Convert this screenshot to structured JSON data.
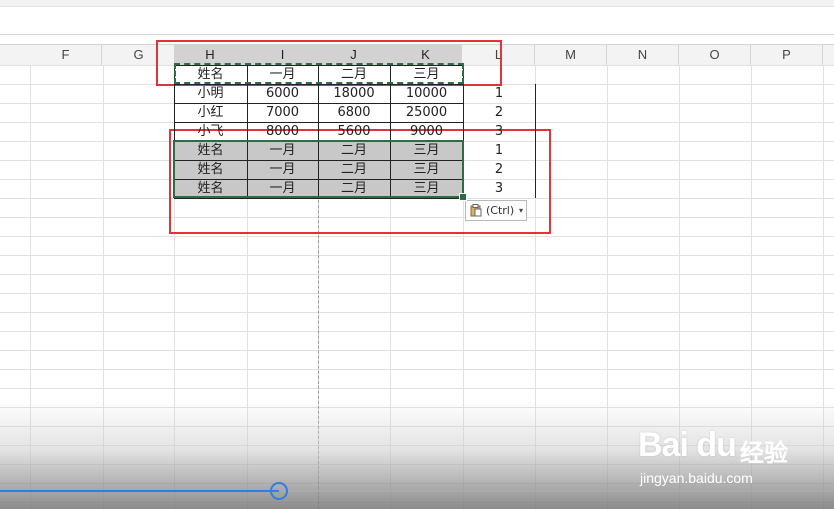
{
  "columns": [
    {
      "id": "F",
      "label": "F",
      "selected": false
    },
    {
      "id": "G",
      "label": "G",
      "selected": false
    },
    {
      "id": "H",
      "label": "H",
      "selected": true
    },
    {
      "id": "I",
      "label": "I",
      "selected": true
    },
    {
      "id": "J",
      "label": "J",
      "selected": true
    },
    {
      "id": "K",
      "label": "K",
      "selected": true
    },
    {
      "id": "L",
      "label": "L",
      "selected": false
    },
    {
      "id": "M",
      "label": "M",
      "selected": false
    },
    {
      "id": "N",
      "label": "N",
      "selected": false
    },
    {
      "id": "O",
      "label": "O",
      "selected": false
    },
    {
      "id": "P",
      "label": "P",
      "selected": false
    }
  ],
  "rows": [
    {
      "name": "姓名",
      "jan": "一月",
      "feb": "二月",
      "mar": "三月",
      "l": ""
    },
    {
      "name": "小明",
      "jan": "6000",
      "feb": "18000",
      "mar": "10000",
      "l": "1"
    },
    {
      "name": "小红",
      "jan": "7000",
      "feb": "6800",
      "mar": "25000",
      "l": "2"
    },
    {
      "name": "小飞",
      "jan": "8000",
      "feb": "5600",
      "mar": "9000",
      "l": "3"
    },
    {
      "name": "姓名",
      "jan": "一月",
      "feb": "二月",
      "mar": "三月",
      "l": "1"
    },
    {
      "name": "姓名",
      "jan": "一月",
      "feb": "二月",
      "mar": "三月",
      "l": "2"
    },
    {
      "name": "姓名",
      "jan": "一月",
      "feb": "二月",
      "mar": "三月",
      "l": "3"
    }
  ],
  "paste_options": {
    "label": "(Ctrl)",
    "icon": "clipboard-icon",
    "caret": "▾"
  },
  "video_progress": {
    "fraction": 0.335
  },
  "watermark": {
    "brand": "Bai du",
    "brand_cn": "经验",
    "url": "jingyan.baidu.com"
  },
  "colors": {
    "selection": "#2e6b46",
    "highlight": "#e0343a",
    "progress": "#2f7fe0"
  }
}
